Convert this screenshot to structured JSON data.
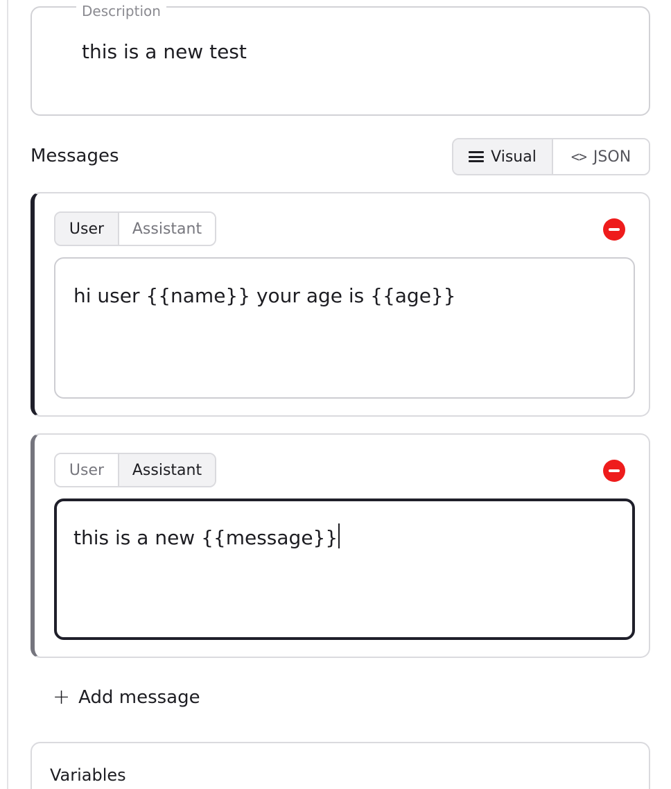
{
  "description": {
    "legend": "Description",
    "value": "this is a new test"
  },
  "messages": {
    "title": "Messages",
    "view_toggle": {
      "visual_label": "Visual",
      "json_label": "JSON",
      "selected": "Visual"
    },
    "items": [
      {
        "role_options": [
          "User",
          "Assistant"
        ],
        "selected_role": "User",
        "content": "hi user {{name}} your age is {{age}}"
      },
      {
        "role_options": [
          "User",
          "Assistant"
        ],
        "selected_role": "Assistant",
        "content": "this is a new {{message}}"
      }
    ],
    "add_label": "Add message"
  },
  "variables": {
    "title": "Variables"
  },
  "icons": {
    "visual": "list-icon",
    "json": "code-icon",
    "remove": "minus-circle-icon",
    "add": "plus-icon"
  },
  "colors": {
    "remove": "#ee1c1c",
    "accent_dark": "#1f1f2a",
    "accent_gray": "#75757e"
  }
}
